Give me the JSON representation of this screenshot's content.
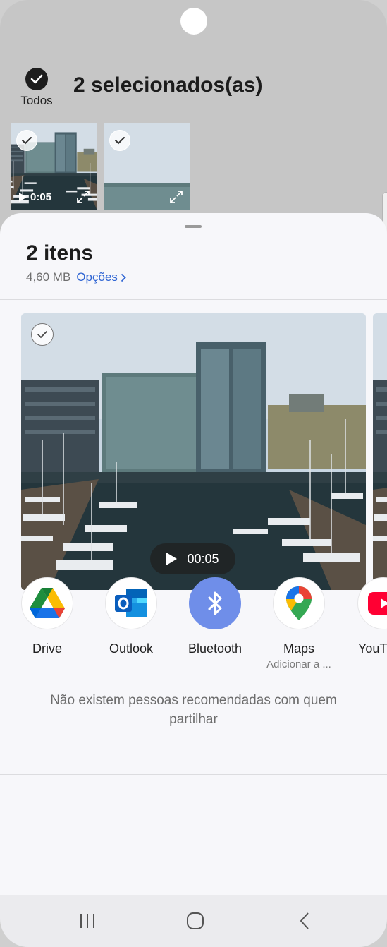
{
  "header": {
    "select_all_label": "Todos",
    "selection_title": "2 selecionados(as)"
  },
  "thumbnails": [
    {
      "duration": "0:05",
      "selected": true,
      "is_video": true
    },
    {
      "selected": true,
      "is_video": false
    }
  ],
  "sheet": {
    "title": "2 itens",
    "size": "4,60 MB",
    "options_label": "Opções",
    "preview": {
      "duration": "00:05"
    },
    "no_people_text": "Não existem pessoas recomendadas com quem partilhar"
  },
  "apps": [
    {
      "label": "Drive",
      "icon": "google-drive-icon"
    },
    {
      "label": "Outlook",
      "icon": "outlook-icon"
    },
    {
      "label": "Bluetooth",
      "icon": "bluetooth-icon",
      "color": "#6f8ee9"
    },
    {
      "label": "Maps",
      "sublabel": "Adicionar a ...",
      "icon": "google-maps-icon"
    },
    {
      "label": "YouT",
      "icon": "youtube-icon",
      "color": "#ff0033"
    }
  ],
  "colors": {
    "accent": "#2f65d3"
  }
}
